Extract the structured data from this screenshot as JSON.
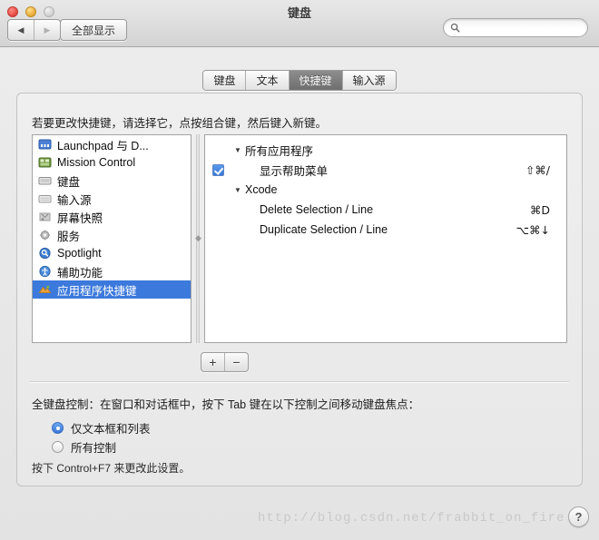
{
  "window": {
    "title": "键盘",
    "traffic_lights": [
      "close",
      "minimize",
      "zoom"
    ]
  },
  "toolbar": {
    "back_icon": "◀",
    "forward_icon": "▶",
    "show_all_label": "全部显示",
    "search_placeholder": "",
    "search_value": "",
    "search_icon": "search-icon"
  },
  "tabs": [
    {
      "label": "键盘",
      "active": false
    },
    {
      "label": "文本",
      "active": false
    },
    {
      "label": "快捷键",
      "active": true
    },
    {
      "label": "输入源",
      "active": false
    }
  ],
  "main": {
    "hint": "若要更改快捷键，请选择它，点按组合键，然后键入新键。",
    "categories": [
      {
        "label": "Launchpad 与 D...",
        "icon": "launchpad-icon",
        "selected": false
      },
      {
        "label": "Mission Control",
        "icon": "mission-control-icon",
        "selected": false
      },
      {
        "label": "键盘",
        "icon": "keyboard-icon",
        "selected": false
      },
      {
        "label": "输入源",
        "icon": "input-source-icon",
        "selected": false
      },
      {
        "label": "屏幕快照",
        "icon": "screenshot-icon",
        "selected": false
      },
      {
        "label": "服务",
        "icon": "services-gear-icon",
        "selected": false
      },
      {
        "label": "Spotlight",
        "icon": "spotlight-icon",
        "selected": false
      },
      {
        "label": "辅助功能",
        "icon": "accessibility-icon",
        "selected": false
      },
      {
        "label": "应用程序快捷键",
        "icon": "app-shortcuts-icon",
        "selected": true
      }
    ],
    "shortcut_tree": [
      {
        "type": "group",
        "label": "所有应用程序",
        "disclosure": "▼"
      },
      {
        "type": "item",
        "label": "显示帮助菜单",
        "shortcut": "⇧⌘/",
        "checked": true
      },
      {
        "type": "group",
        "label": "Xcode",
        "disclosure": "▼"
      },
      {
        "type": "item",
        "label": "Delete Selection / Line",
        "shortcut": "⌘D",
        "checked": false
      },
      {
        "type": "item",
        "label": "Duplicate Selection / Line",
        "shortcut": "⌥⌘↓",
        "checked": false
      }
    ],
    "add_button_label": "+",
    "remove_button_label": "−",
    "full_keyboard_access": {
      "title": "全键盘控制：在窗口和对话框中，按下 Tab 键在以下控制之间移动键盘焦点：",
      "options": [
        {
          "label": "仅文本框和列表",
          "selected": true
        },
        {
          "label": "所有控制",
          "selected": false
        }
      ],
      "footnote": "按下 Control+F7 来更改此设置。"
    }
  },
  "overlay": {
    "watermark": "http://blog.csdn.net/frabbit_on_fire",
    "help_label": "?"
  },
  "colors": {
    "selection_blue": "#3c79dc",
    "active_tab": "#7b7b7b",
    "panel_bg": "#ebebeb"
  }
}
